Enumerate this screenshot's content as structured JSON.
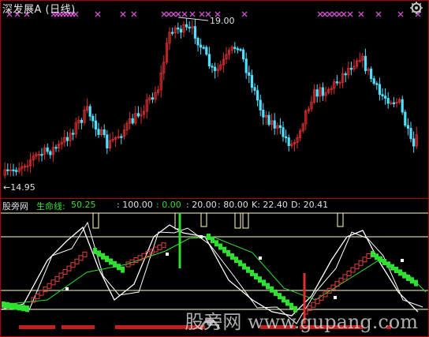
{
  "window": {
    "title": "深发展A (日线)"
  },
  "main_chart": {
    "high_label": "19.00",
    "low_label": "←14.95"
  },
  "indicator": {
    "name": "股旁网",
    "lifeline_label": "生命线:",
    "lifeline_value": "50.25",
    "levels": [
      ": 100.00",
      ": 0.00",
      ": 20.00",
      ": 80.00"
    ],
    "k_label": "K: 22.40",
    "d_label": "D: 20.41"
  },
  "watermark": {
    "text": "股旁网 www.gupang.com"
  },
  "colors": {
    "up_candle": "#e03030",
    "down_candle": "#50e0ff",
    "signal_cross": "#d050d0",
    "lifeline_value": "#30e030",
    "k_line": "#ffffff",
    "d_line": "#ffffff",
    "level_line": "#ffffc0",
    "rising_blocks": "#e04040",
    "falling_blocks": "#30e030"
  },
  "icons": {
    "settings": "gear-icon"
  }
}
